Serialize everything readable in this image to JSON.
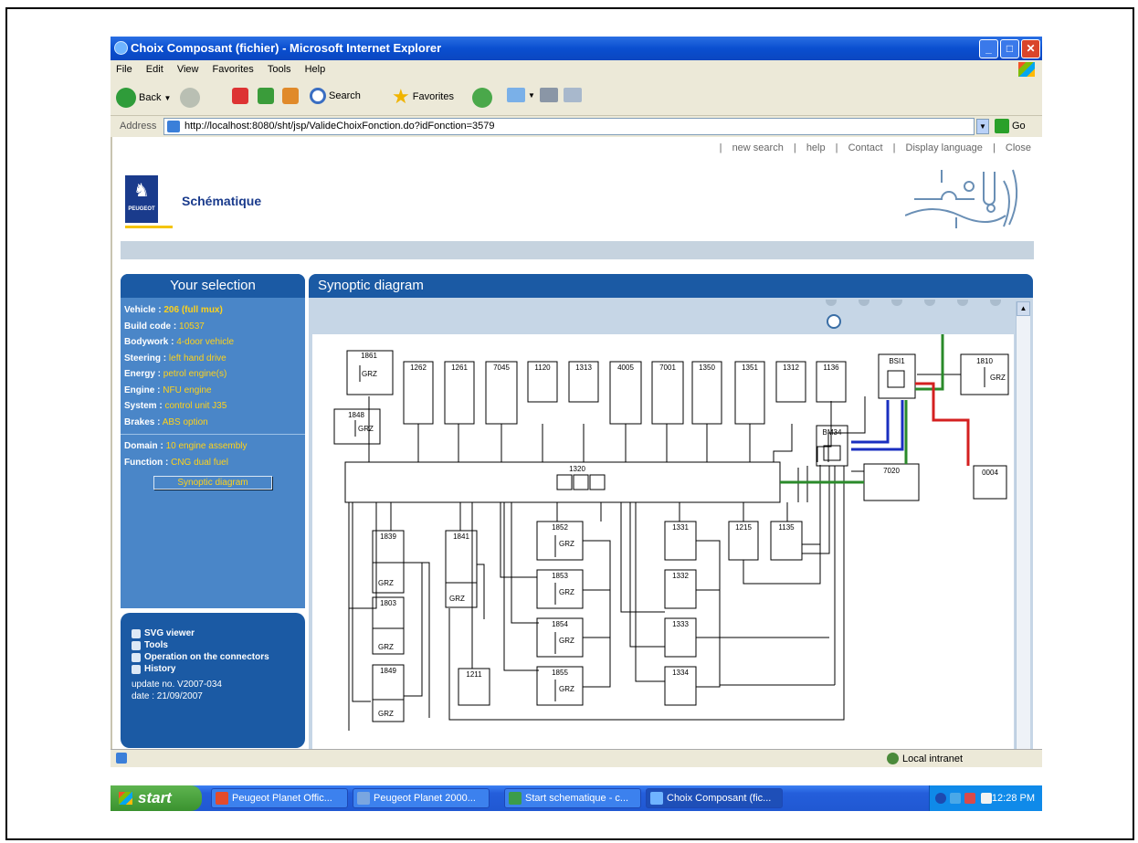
{
  "window": {
    "title": "Choix Composant (fichier) - Microsoft Internet Explorer",
    "min": "_",
    "max": "□",
    "close": "✕"
  },
  "menu": [
    "File",
    "Edit",
    "View",
    "Favorites",
    "Tools",
    "Help"
  ],
  "toolbar": {
    "back": "Back",
    "search": "Search",
    "favorites": "Favorites"
  },
  "address": {
    "label": "Address",
    "url": "http://localhost:8080/sht/jsp/ValideChoixFonction.do?idFonction=3579",
    "go": "Go"
  },
  "page": {
    "links": [
      "new search",
      "help",
      "Contact",
      "Display language",
      "Close"
    ],
    "separator": "|",
    "brand": "PEUGEOT",
    "app_title": "Schématique"
  },
  "selection": {
    "title": "Your selection",
    "rows": [
      {
        "label": "Vehicle :",
        "value": "206 (full mux)"
      },
      {
        "label": "Build code :",
        "value": "10537"
      },
      {
        "label": "Bodywork :",
        "value": "4-door vehicle"
      },
      {
        "label": "Steering :",
        "value": "left hand drive"
      },
      {
        "label": "Energy :",
        "value": "petrol engine(s)"
      },
      {
        "label": "Engine :",
        "value": "NFU engine"
      },
      {
        "label": "System :",
        "value": "control unit J35"
      },
      {
        "label": "Brakes :",
        "value": "ABS option"
      }
    ],
    "rows2": [
      {
        "label": "Domain :",
        "value": "10 engine assembly"
      },
      {
        "label": "Function :",
        "value": "CNG dual fuel"
      }
    ],
    "button": "Synoptic diagram"
  },
  "tools": {
    "items": [
      "SVG viewer",
      "Tools",
      "Operation on the connectors",
      "History"
    ],
    "update": "update no. V2007-034",
    "date": "date : 21/09/2007"
  },
  "synoptic": {
    "title": "Synoptic diagram"
  },
  "diagram": {
    "top_components": [
      "1861",
      "1262",
      "1261",
      "7045",
      "1120",
      "1313",
      "4005",
      "7001",
      "1350",
      "1351",
      "1312",
      "1136",
      "BSI1",
      "1810"
    ],
    "central": "1320",
    "others": [
      "1848",
      "BM34",
      "7020",
      "0004",
      "1839",
      "1841",
      "1803",
      "1849",
      "1211",
      "1852",
      "1853",
      "1854",
      "1855",
      "1331",
      "1332",
      "1333",
      "1334",
      "1215",
      "1135"
    ],
    "grz": "GRZ"
  },
  "status": {
    "zone": "Local intranet"
  },
  "taskbar": {
    "start": "start",
    "tasks": [
      "Peugeot Planet Offic...",
      "Peugeot Planet 2000...",
      "Start schematique - c...",
      "Choix Composant (fic..."
    ],
    "clock": "12:28 PM"
  },
  "colors": {
    "accent": "#1b5aa4",
    "highlight": "#ffd21a",
    "wire_red": "#d42020",
    "wire_green": "#2a8a2a",
    "wire_blue": "#1a2fc0"
  }
}
